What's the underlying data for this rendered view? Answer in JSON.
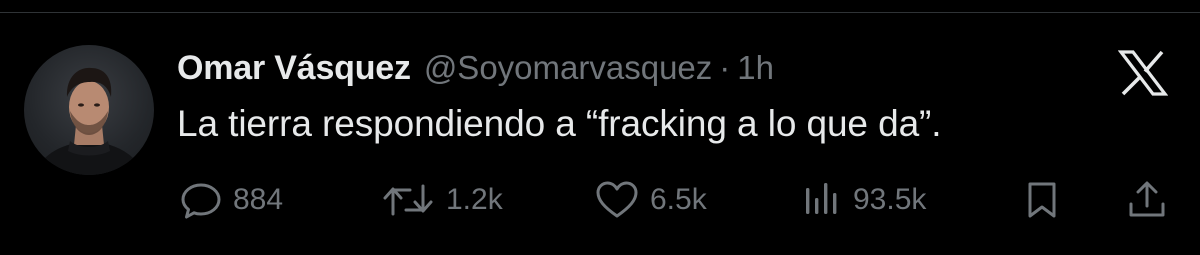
{
  "tweet": {
    "author": {
      "display_name": "Omar Vásquez",
      "handle": "@Soyomarvasquez",
      "avatar_icon": "avatar"
    },
    "separator": "·",
    "time": "1h",
    "text": "La tierra respondiendo a “fracking a lo que da”.",
    "brand_icon": "x-logo-icon",
    "actions": {
      "reply": {
        "icon": "reply-icon",
        "count": "884"
      },
      "retweet": {
        "icon": "retweet-icon",
        "count": "1.2k"
      },
      "like": {
        "icon": "heart-icon",
        "count": "6.5k"
      },
      "views": {
        "icon": "views-icon",
        "count": "93.5k"
      },
      "bookmark": {
        "icon": "bookmark-icon"
      },
      "share": {
        "icon": "share-icon"
      }
    }
  },
  "colors": {
    "background": "#000000",
    "primary_text": "#e7e9ea",
    "secondary_text": "#71767b",
    "divider": "#2f3336"
  }
}
